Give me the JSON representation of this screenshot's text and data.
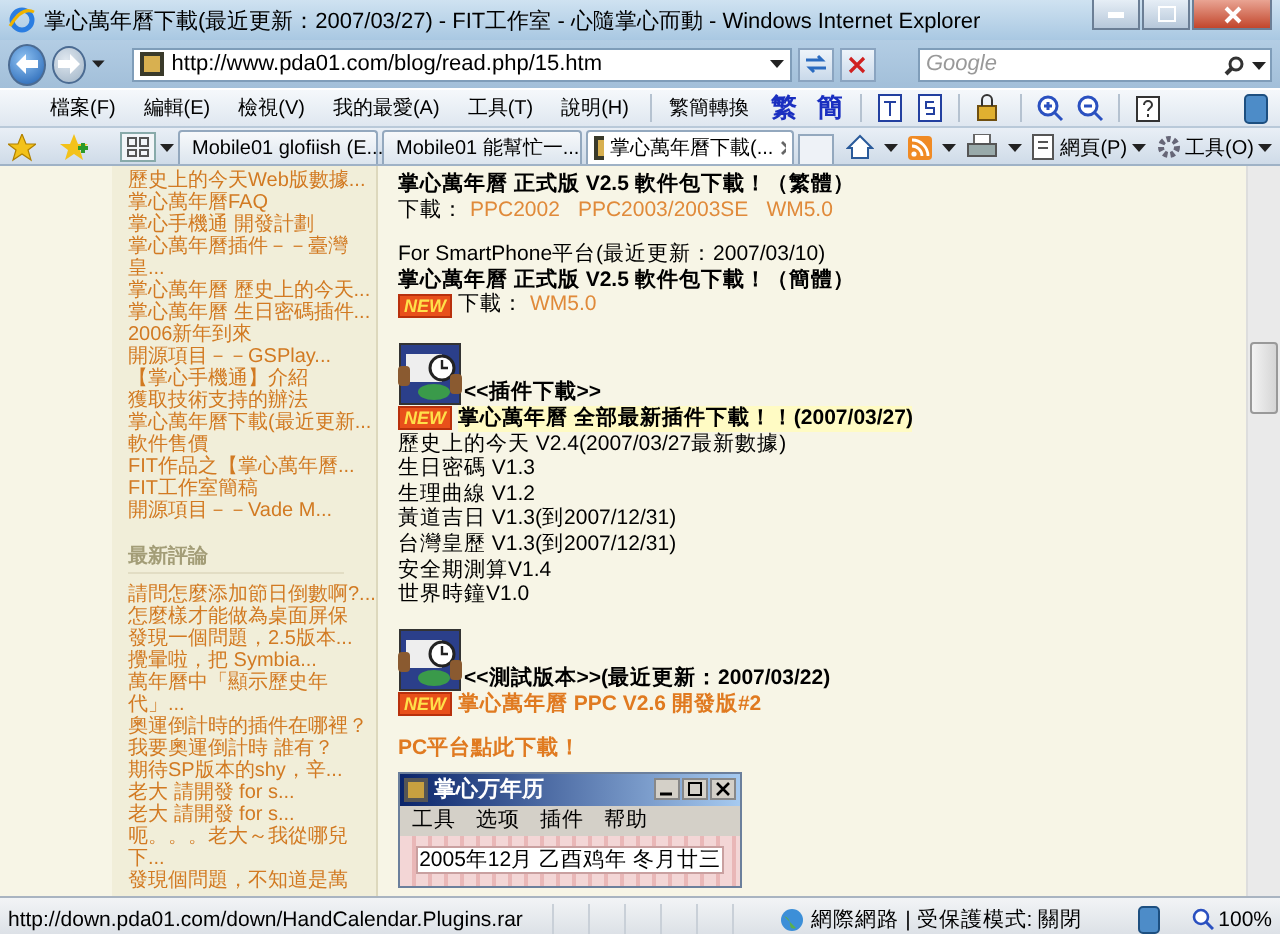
{
  "window": {
    "title": "掌心萬年曆下載(最近更新：2007/03/27) - FIT工作室 - 心隨掌心而動 - Windows Internet Explorer"
  },
  "address_bar": {
    "url": "http://www.pda01.com/blog/read.php/15.htm"
  },
  "search": {
    "placeholder": "Google"
  },
  "menu": [
    "檔案(F)",
    "編輯(E)",
    "檢視(V)",
    "我的最愛(A)",
    "工具(T)",
    "說明(H)"
  ],
  "converter": {
    "label": "繁簡轉換",
    "buttons": [
      "繁",
      "簡"
    ]
  },
  "tabs": [
    {
      "label": "Mobile01 glofiish (E...",
      "selected": false
    },
    {
      "label": "Mobile01 能幫忙一...",
      "selected": false
    },
    {
      "label": "掌心萬年曆下載(...",
      "selected": true
    }
  ],
  "command_bar": [
    "網頁(P)",
    "工具(O)"
  ],
  "sidebar": {
    "articles": [
      "歷史上的今天Web版數據...",
      "掌心萬年曆FAQ",
      "掌心手機通 開發計劃",
      "掌心萬年曆插件－－臺灣皇...",
      "掌心萬年曆 歷史上的今天...",
      "掌心萬年曆 生日密碼插件...",
      "2006新年到來",
      "開源項目－－GSPlay...",
      "【掌心手機通】介紹",
      "獲取技術支持的辦法",
      "掌心萬年曆下載(最近更新...",
      "軟件售價",
      "FIT作品之【掌心萬年曆...",
      "FIT工作室簡稿",
      "開源項目－－Vade M..."
    ],
    "comments_heading": "最新評論",
    "comments": [
      "請問怎麼添加節日倒數啊?...",
      "怎麼樣才能做為桌面屏保",
      "發現一個問題，2.5版本...",
      "攪暈啦，把 Symbia...",
      "萬年曆中「顯示歷史年代」...",
      "奧運倒計時的插件在哪裡？",
      "我要奧運倒計時 誰有？",
      "期待SP版本的shy，辛...",
      "老大 請開發 for s...",
      "老大 請開發 for s...",
      "呃。。。老大～我從哪兒下...",
      "發現個問題，不知道是萬"
    ]
  },
  "content": {
    "sections": [
      {
        "lines": [
          {
            "kind": "bold",
            "text": "掌心萬年曆  正式版  V2.5 軟件包下載！（繁體）",
            "highlighted": false
          },
          {
            "kind": "links",
            "label": "下載：",
            "links": [
              "PPC2002",
              "PPC2003/2003SE",
              "WM5.0"
            ]
          }
        ]
      },
      {
        "lines": [
          {
            "kind": "text",
            "text": "For SmartPhone平台(最近更新：2007/03/10)"
          },
          {
            "kind": "bold",
            "text": "掌心萬年曆  正式版  V2.5 軟件包下載！（簡體）",
            "highlighted": false
          },
          {
            "kind": "links",
            "badge": "NEW",
            "label": "下載：",
            "links": [
              "WM5.0"
            ]
          }
        ]
      },
      {
        "lines": [
          {
            "kind": "icon-heading",
            "text": "<<插件下載>>"
          },
          {
            "kind": "bold",
            "badge": "NEW",
            "text": "掌心萬年曆  全部最新插件下載！！(2007/03/27)",
            "highlighted": true
          },
          {
            "kind": "text",
            "text": "歷史上的今天  V2.4(2007/03/27最新數據)"
          },
          {
            "kind": "text",
            "text": "生日密碼  V1.3"
          },
          {
            "kind": "text",
            "text": "生理曲線  V1.2"
          },
          {
            "kind": "text",
            "text": "黃道吉日  V1.3(到2007/12/31)"
          },
          {
            "kind": "text",
            "text": "台灣皇歷  V1.3(到2007/12/31)"
          },
          {
            "kind": "text",
            "text": "安全期測算V1.4"
          },
          {
            "kind": "text",
            "text": "世界時鐘V1.0"
          }
        ]
      },
      {
        "lines": [
          {
            "kind": "icon-heading",
            "text": "<<測試版本>>(最近更新：2007/03/22)"
          },
          {
            "kind": "accent",
            "badge": "NEW",
            "text": "掌心萬年曆  PPC V2.6 開發版#2"
          }
        ]
      },
      {
        "lines": [
          {
            "kind": "accent",
            "text": "PC平台點此下載！"
          },
          {
            "kind": "app-window",
            "title": "掌心万年历",
            "menus": [
              "工具",
              "选项",
              "插件",
              "帮助"
            ],
            "date": "2005年12月 乙酉鸡年 冬月廿三"
          }
        ]
      }
    ]
  },
  "status_bar": {
    "url": "http://down.pda01.com/down/HandCalendar.Plugins.rar",
    "zone": "網際網路 | 受保護模式: 關閉",
    "zoom": "100%"
  }
}
